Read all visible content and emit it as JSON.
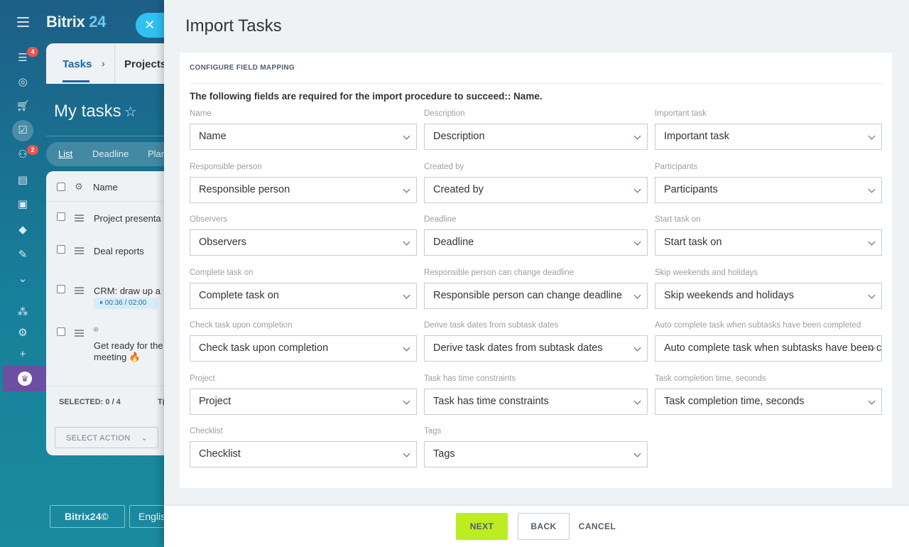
{
  "app": {
    "logo_text": "Bitrix",
    "logo_num": "24",
    "badges": {
      "feed": "4",
      "contacts": "2"
    },
    "nav": {
      "tab1": "Tasks",
      "sep": "›",
      "tab2": "Projects"
    },
    "page_title": "My tasks",
    "star": "☆",
    "view_tabs": {
      "list": "List",
      "deadline": "Deadline",
      "planner": "Plan"
    },
    "list_header": "Name",
    "rows": [
      {
        "text": "Project presenta"
      },
      {
        "text": "Deal reports"
      },
      {
        "text": "CRM: draw up a"
      },
      {
        "text": "Get ready for the"
      }
    ],
    "row4_line2": "meeting 🔥",
    "timer": "⏸ 00:36 / 02:00",
    "selected": "SELECTED: 0 / 4",
    "total_clip": "T(",
    "select_action": "SELECT ACTION",
    "bitrix_button": "Bitrix24©",
    "lang_button": "English"
  },
  "panel": {
    "title": "Import Tasks",
    "section_title": "CONFIGURE FIELD MAPPING",
    "required_note": "The following fields are required for the import procedure to succeed:: Name.",
    "fields": [
      {
        "label": "Name",
        "value": "Name"
      },
      {
        "label": "Description",
        "value": "Description"
      },
      {
        "label": "Important task",
        "value": "Important task"
      },
      {
        "label": "Responsible person",
        "value": "Responsible person"
      },
      {
        "label": "Created by",
        "value": "Created by"
      },
      {
        "label": "Participants",
        "value": "Participants"
      },
      {
        "label": "Observers",
        "value": "Observers"
      },
      {
        "label": "Deadline",
        "value": "Deadline"
      },
      {
        "label": "Start task on",
        "value": "Start task on"
      },
      {
        "label": "Complete task on",
        "value": "Complete task on"
      },
      {
        "label": "Responsible person can change deadline",
        "value": "Responsible person can change deadline"
      },
      {
        "label": "Skip weekends and holidays",
        "value": "Skip weekends and holidays"
      },
      {
        "label": "Check task upon completion",
        "value": "Check task upon completion"
      },
      {
        "label": "Derive task dates from subtask dates",
        "value": "Derive task dates from subtask dates"
      },
      {
        "label": "Auto complete task when subtasks have been completed",
        "value": "Auto complete task when subtasks have been completed"
      },
      {
        "label": "Project",
        "value": "Project"
      },
      {
        "label": "Task has time constraints",
        "value": "Task has time constraints"
      },
      {
        "label": "Task completion time, seconds",
        "value": "Task completion time, seconds"
      },
      {
        "label": "Checklist",
        "value": "Checklist"
      },
      {
        "label": "Tags",
        "value": "Tags"
      }
    ],
    "buttons": {
      "next": "NEXT",
      "back": "BACK",
      "cancel": "CANCEL"
    }
  }
}
